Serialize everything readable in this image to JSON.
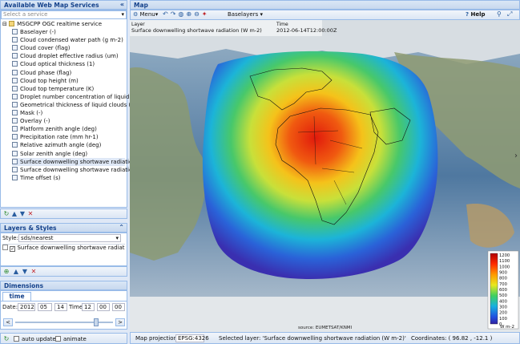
{
  "left_panel": {
    "title": "Available Web Map Services",
    "search_placeholder": "Select a service",
    "service_name": "MSGCPP OGC realtime service",
    "layers": [
      "Baselayer (-)",
      "Cloud condensed water path (g m-2)",
      "Cloud cover (flag)",
      "Cloud droplet effective radius (um)",
      "Cloud optical thickness (1)",
      "Cloud phase (flag)",
      "Cloud top height (m)",
      "Cloud top temperature (K)",
      "Droplet number concentration of liquid clo",
      "Geometrical thickness of liquid clouds (m)",
      "Mask (-)",
      "Overlay (-)",
      "Platform zenith angle (deg)",
      "Precipitation rate (mm hr-1)",
      "Relative azimuth angle (deg)",
      "Solar zenith angle (deg)",
      "Surface downwelling shortwave radiation (W",
      "Surface downwelling shortwave radiation a",
      "Time offset (s)"
    ],
    "selected_index": 16
  },
  "layers_styles": {
    "title": "Layers & Styles",
    "style_label": "Style:",
    "style_value": "sds/nearest",
    "active_layer": "Surface downwelling shortwave radiation (W"
  },
  "dimensions": {
    "title": "Dimensions",
    "tab": "time",
    "date_label": "Date:",
    "year": "2012",
    "month": "05",
    "day": "14",
    "time_label": "Time:",
    "hour": "12",
    "minute": "00",
    "second": "00",
    "prev": "<",
    "next": ">"
  },
  "footer_left": {
    "auto_update": "auto update",
    "animate": "animate"
  },
  "map": {
    "title": "Map",
    "menu_label": "Menu",
    "baselayers_label": "Baselayers",
    "help_label": "Help",
    "info_layer": "Layer",
    "info_layer_value": "Surface downwelling shortwave radiation (W m-2)",
    "info_time": "Time",
    "info_time_value": "2012-06-14T12:00:00Z",
    "source": "source: EUMETSAT/KNMI",
    "legend_ticks": [
      "1200",
      "1100",
      "1000",
      "900",
      "800",
      "700",
      "600",
      "500",
      "400",
      "300",
      "200",
      "100",
      "0"
    ],
    "legend_unit": "W m-2"
  },
  "statusbar": {
    "projection_label": "Map projection:",
    "projection_value": "EPSG:4326",
    "selected_layer": "Selected layer: 'Surface downwelling shortwave radiation (W m-2)'",
    "coordinates": "Coordinates: ( 96.82 , -12.1 )"
  }
}
